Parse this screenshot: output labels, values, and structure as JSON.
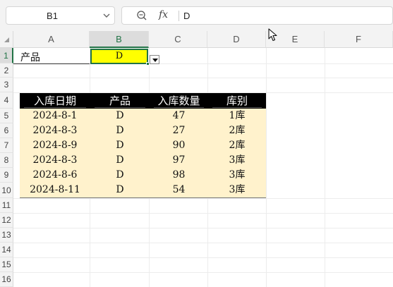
{
  "toolbar": {
    "name_box": "B1",
    "formula_text": "D",
    "fx_label": "fx"
  },
  "columns": [
    "A",
    "B",
    "C",
    "D",
    "E",
    "F"
  ],
  "rows": [
    "1",
    "2",
    "3",
    "4",
    "5",
    "6",
    "7",
    "8",
    "9",
    "10",
    "11",
    "12",
    "13",
    "14",
    "15",
    "16"
  ],
  "selected_column": "B",
  "selected_row": "1",
  "cells": {
    "a1": "产品",
    "b1": "D"
  },
  "table": {
    "headers": [
      "入库日期",
      "产品",
      "入库数量",
      "库别"
    ],
    "rows": [
      [
        "2024-8-1",
        "D",
        "47",
        "1库"
      ],
      [
        "2024-8-3",
        "D",
        "27",
        "2库"
      ],
      [
        "2024-8-9",
        "D",
        "90",
        "2库"
      ],
      [
        "2024-8-3",
        "D",
        "97",
        "3库"
      ],
      [
        "2024-8-6",
        "D",
        "98",
        "3库"
      ],
      [
        "2024-8-11",
        "D",
        "54",
        "3库"
      ]
    ]
  },
  "colors": {
    "selection": "#217346",
    "b1_fill": "#ffff00",
    "header_fill": "#000000",
    "row_fill": "#fff2cc"
  }
}
